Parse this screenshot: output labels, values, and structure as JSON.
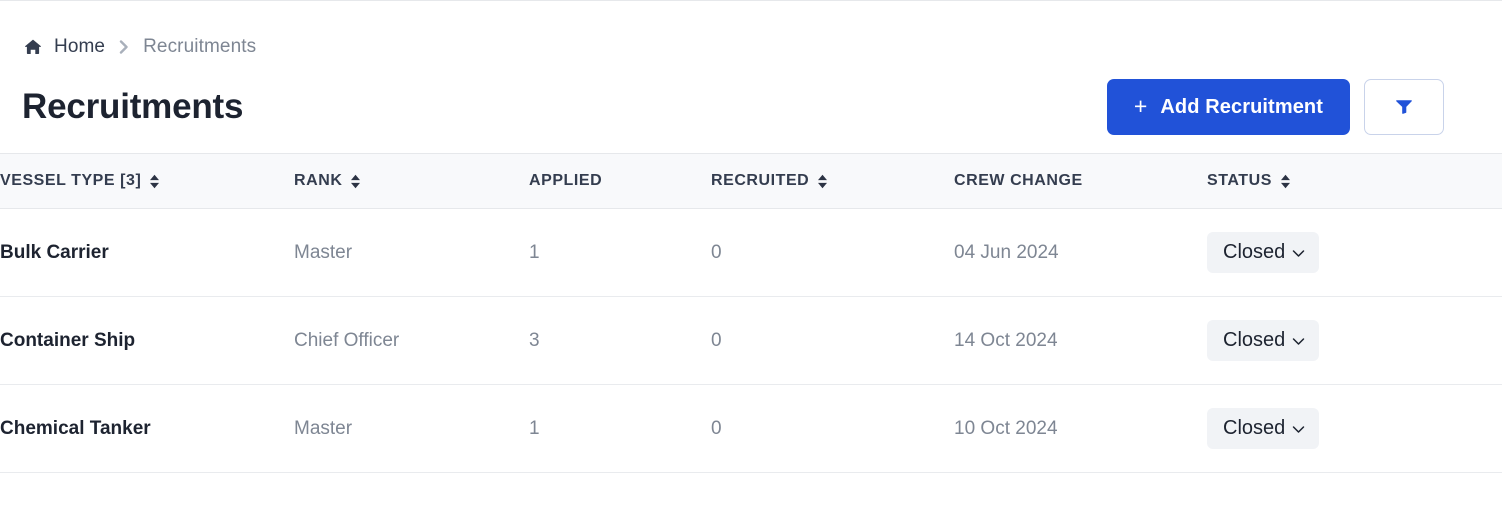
{
  "breadcrumb": {
    "home_icon": "home-icon",
    "home_label": "Home",
    "separator_icon": "chevron-right-icon",
    "current_label": "Recruitments"
  },
  "header": {
    "title": "Recruitments",
    "add_button_label": "Add Recruitment",
    "add_button_icon": "plus-icon",
    "filter_button_icon": "filter-icon",
    "accent_color": "#2152d8"
  },
  "table": {
    "columns": [
      {
        "label": "VESSEL TYPE [3]",
        "sortable": true
      },
      {
        "label": "RANK",
        "sortable": true
      },
      {
        "label": "APPLIED",
        "sortable": false
      },
      {
        "label": "RECRUITED",
        "sortable": true
      },
      {
        "label": "CREW CHANGE",
        "sortable": false
      },
      {
        "label": "STATUS",
        "sortable": true
      }
    ],
    "rows": [
      {
        "vessel_type": "Bulk Carrier",
        "rank": "Master",
        "applied": "1",
        "recruited": "0",
        "crew_change": "04 Jun 2024",
        "status": "Closed"
      },
      {
        "vessel_type": "Container Ship",
        "rank": "Chief Officer",
        "applied": "3",
        "recruited": "0",
        "crew_change": "14 Oct 2024",
        "status": "Closed"
      },
      {
        "vessel_type": "Chemical Tanker",
        "rank": "Master",
        "applied": "1",
        "recruited": "0",
        "crew_change": "10 Oct 2024",
        "status": "Closed"
      }
    ]
  }
}
